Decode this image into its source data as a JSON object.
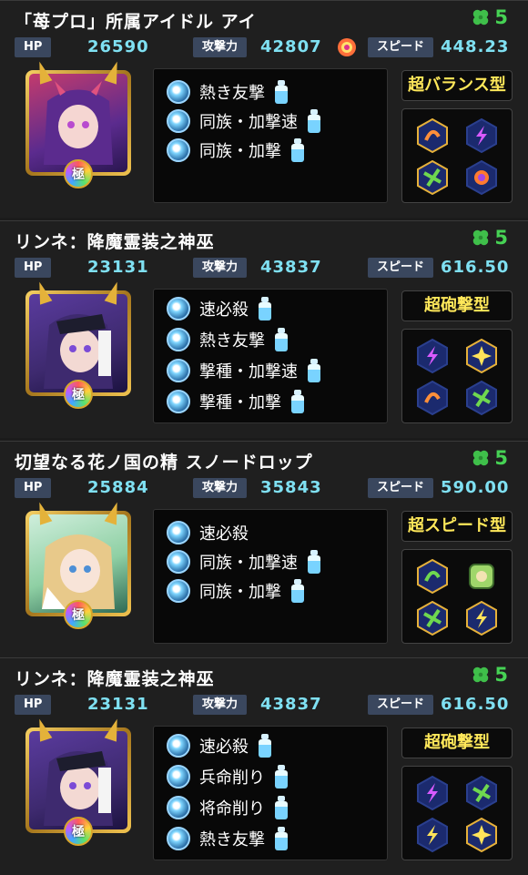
{
  "cards": [
    {
      "name": "「苺プロ」所属アイドル アイ",
      "luck": "5",
      "hp_label": "HP",
      "hp": "26590",
      "atk_label": "攻撃力",
      "atk": "42807",
      "spd_label": "スピード",
      "spd": "448.23",
      "type": "超バランス型",
      "abilities": [
        "熱き友撃",
        "同族・加撃速",
        "同族・加撃"
      ],
      "gauges": [
        "recovery-icon",
        "lightning-icon",
        "dark-blast-icon",
        "sun-gear-icon"
      ],
      "colors": {
        "hair": "#5b2b8e",
        "bg": "#c33b6d"
      }
    },
    {
      "name": "リンネ：降魔霊装之神巫",
      "luck": "5",
      "hp_label": "HP",
      "hp": "23131",
      "atk_label": "攻撃力",
      "atk": "43837",
      "spd_label": "スピード",
      "spd": "616.50",
      "type": "超砲撃型",
      "abilities": [
        "速必殺",
        "熱き友撃",
        "撃種・加撃速",
        "撃種・加撃"
      ],
      "gauges": [
        "lightning-icon",
        "burst-icon",
        "recovery-icon",
        "dark-blast-icon"
      ],
      "colors": {
        "hair": "#3e2a6f",
        "bg": "#5a3b9e"
      }
    },
    {
      "name": "切望なる花ノ国の精 スノードロップ",
      "luck": "5",
      "hp_label": "HP",
      "hp": "25884",
      "atk_label": "攻撃力",
      "atk": "35843",
      "spd_label": "スピード",
      "spd": "590.00",
      "type": "超スピード型",
      "abilities": [
        "速必殺",
        "同族・加撃速",
        "同族・加撃"
      ],
      "gauges": [
        "recovery-icon",
        "hand-card-icon",
        "dark-blast-icon",
        "lightning-icon"
      ],
      "colors": {
        "hair": "#e8c98a",
        "bg": "#8fd0a4"
      }
    },
    {
      "name": "リンネ：降魔霊装之神巫",
      "luck": "5",
      "hp_label": "HP",
      "hp": "23131",
      "atk_label": "攻撃力",
      "atk": "43837",
      "spd_label": "スピード",
      "spd": "616.50",
      "type": "超砲撃型",
      "abilities": [
        "速必殺",
        "兵命削り",
        "将命削り",
        "熱き友撃"
      ],
      "gauges": [
        "lightning-icon",
        "dark-blast-icon",
        "lightning-icon",
        "burst-icon"
      ],
      "colors": {
        "hair": "#3e2a6f",
        "bg": "#5a3b9e"
      }
    }
  ],
  "colors": {
    "accent_stat": "#7fe0f2",
    "luck_green": "#46d254",
    "type_yellow": "#ffe85a"
  }
}
